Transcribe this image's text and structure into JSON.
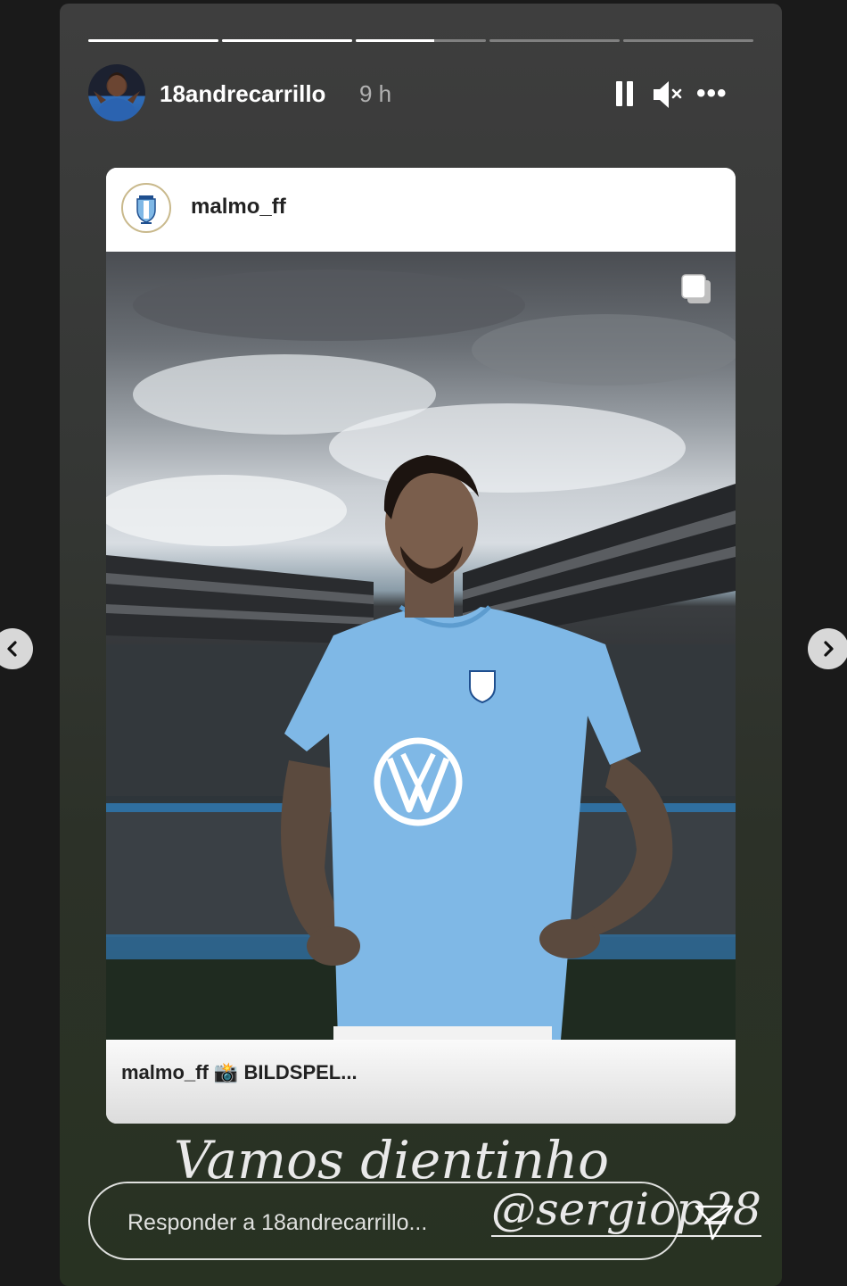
{
  "story": {
    "progress": [
      1,
      1,
      0.6,
      0,
      0
    ],
    "user": {
      "username": "18andrecarrillo",
      "time": "9 h"
    },
    "controls": {
      "more_label": "•••"
    },
    "shared_post": {
      "account": "malmo_ff",
      "footer_user": "malmo_ff",
      "footer_emoji": "📸",
      "footer_text": "BILDSPEL..."
    },
    "caption_line1": "Vamos dientinho",
    "caption_mention": "@sergiop28",
    "reply": {
      "placeholder": "Responder a 18andrecarrillo..."
    }
  },
  "icons": [
    "pause-icon",
    "mute-icon",
    "more-icon",
    "carousel-icon",
    "send-icon",
    "chevron-left-icon",
    "chevron-right-icon"
  ]
}
